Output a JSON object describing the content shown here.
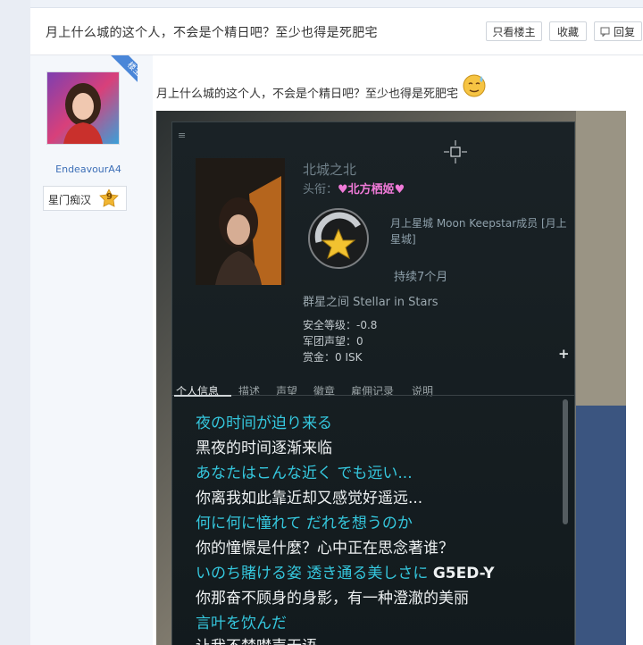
{
  "thread": {
    "title": "月上什么城的这个人，不会是个精日吧？至少也得是死肥宅",
    "buttons": [
      "只看楼主",
      "收藏",
      "回复"
    ]
  },
  "author": {
    "badge": "楼主",
    "name": "EndeavourA4",
    "rank": "星门痴汉",
    "level": "9"
  },
  "post": {
    "text": "月上什么城的这个人，不会是个精日吧？至少也得是死肥宅"
  },
  "game": {
    "char_name": "北城之北",
    "title_label": "头衔：",
    "title_value": "♥北方栖姬♥",
    "corp": "月上星城 Moon Keepstar成员 [月上星城]",
    "tenure": "持续7个月",
    "alliance": "群星之间 Stellar in Stars",
    "security": "安全等级：-0.8",
    "standing": "军团声望：0",
    "bounty": "赏金：0 ISK",
    "tabs": [
      "个人信息",
      "描述",
      "声望",
      "徽章",
      "雇佣记录",
      "说明"
    ],
    "lyrics": [
      {
        "text": "夜の时间が迫り来る",
        "color": "cyan"
      },
      {
        "text": "黑夜的时间逐渐来临",
        "color": "white"
      },
      {
        "text": "あなたはこんな近く でも远い...",
        "color": "cyan"
      },
      {
        "text": "你离我如此靠近却又感觉好遥远...",
        "color": "white"
      },
      {
        "text": "何に何に憧れて だれを想うのか",
        "color": "cyan"
      },
      {
        "text": "你的憧憬是什麼？心中正在思念著谁？",
        "color": "white"
      },
      {
        "text": "いのち賭ける姿 透き通る美しさに",
        "color": "cyan",
        "tag": "G5ED-Y"
      },
      {
        "text": "你那奋不顾身的身影，有一种澄澈的美丽",
        "color": "white"
      },
      {
        "text": "言叶を饮んだ",
        "color": "cyan"
      },
      {
        "text": "让我不禁噤声无语",
        "color": "white"
      }
    ]
  }
}
